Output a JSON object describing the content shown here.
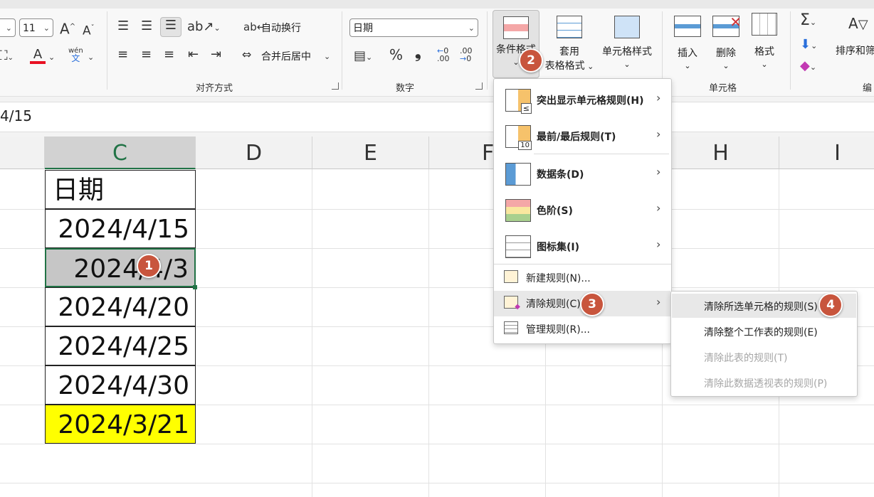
{
  "ribbon": {
    "font_size": "11",
    "font_grow": "A",
    "font_shrink": "A",
    "font_color_letter": "A",
    "phonetic_top": "wén",
    "phonetic_bottom": "文",
    "wrap_text": "自动换行",
    "merge_center": "合并后居中",
    "alignment_group": "对齐方式",
    "number_format": "日期",
    "percent": "%",
    "comma": "❟",
    "inc_decimal": ".00",
    "dec_decimal": ".00",
    "number_group": "数字",
    "conditional_format": "条件格式",
    "table_format_1": "套用",
    "table_format_2": "表格格式",
    "cell_styles": "单元格样式",
    "insert": "插入",
    "delete": "删除",
    "format": "格式",
    "cells_group": "单元格",
    "sort_filter": "排序和筛",
    "edit_group": "编"
  },
  "formula_bar": {
    "value": "4/15"
  },
  "columns": [
    "C",
    "D",
    "E",
    "F",
    "H",
    "I"
  ],
  "cells": {
    "header": "日期",
    "rows": [
      "2024/4/15",
      "2024/4/3",
      "2024/4/20",
      "2024/4/25",
      "2024/4/30",
      "2024/3/21"
    ]
  },
  "cf_menu": {
    "items": [
      {
        "label": "突出显示单元格规则(H)"
      },
      {
        "label": "最前/最后规则(T)"
      },
      {
        "label": "数据条(D)"
      },
      {
        "label": "色阶(S)"
      },
      {
        "label": "图标集(I)"
      }
    ],
    "new_rule": "新建规则(N)...",
    "clear_rules": "清除规则(C)",
    "manage_rules": "管理规则(R)...",
    "icon_badge_10": "10"
  },
  "clear_submenu": {
    "items": [
      {
        "label": "清除所选单元格的规则(S)",
        "enabled": true
      },
      {
        "label": "清除整个工作表的规则(E)",
        "enabled": true
      },
      {
        "label": "清除此表的规则(T)",
        "enabled": false
      },
      {
        "label": "清除此数据透视表的规则(P)",
        "enabled": false
      }
    ]
  },
  "badges": [
    "1",
    "2",
    "3",
    "4"
  ],
  "colors": {
    "accent_green": "#217346",
    "badge": "#c8553d",
    "highlight": "#ffff00",
    "selected_fill": "#c6c6c6"
  }
}
